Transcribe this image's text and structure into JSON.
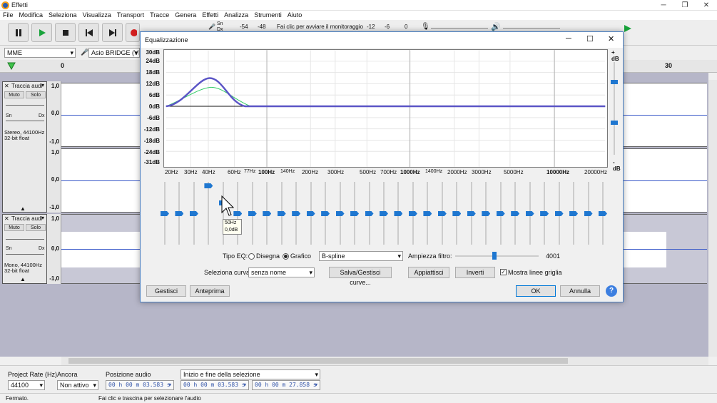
{
  "window": {
    "title": "Effetti"
  },
  "menu": [
    "File",
    "Modifica",
    "Seleziona",
    "Visualizza",
    "Transport",
    "Tracce",
    "Genera",
    "Effetti",
    "Analizza",
    "Strumenti",
    "Aiuto"
  ],
  "meter": {
    "ticks": [
      "-54",
      "-48",
      "-12",
      "-6",
      "0"
    ],
    "monitor_text": "Fai clic per avviare il monitoraggio",
    "rec_labels": [
      "Sn",
      "Dx"
    ]
  },
  "device": {
    "host": "MME",
    "input": "Asio BRIDGE (VB-Au"
  },
  "ruler": {
    "left": "0",
    "right": "30"
  },
  "tracks": [
    {
      "name": "Traccia audi",
      "mute": "Muto",
      "solo": "Solo",
      "pan_l": "Sn",
      "pan_r": "Dx",
      "info1": "Stereo, 44100Hz",
      "info2": "32-bit float",
      "scale": [
        "1,0",
        "0,0",
        "-1,0",
        "1,0",
        "0,0",
        "-1,0"
      ]
    },
    {
      "name": "Traccia audi",
      "mute": "Muto",
      "solo": "Solo",
      "pan_l": "Sn",
      "pan_r": "Dx",
      "info1": "Mono, 44100Hz",
      "info2": "32-bit float",
      "scale": [
        "1,0",
        "0,0",
        "-1,0"
      ]
    }
  ],
  "dialog": {
    "title": "Equalizzazione",
    "db_labels": [
      "30dB",
      "24dB",
      "18dB",
      "12dB",
      "6dB",
      "0dB",
      "-6dB",
      "-12dB",
      "-18dB",
      "-24dB",
      "-31dB"
    ],
    "right_top": "+ dB",
    "right_bottom": "- dB",
    "freq_labels": [
      "20Hz",
      "30Hz",
      "40Hz",
      "60Hz",
      "77Hz",
      "100Hz",
      "140Hz",
      "200Hz",
      "300Hz",
      "500Hz",
      "700Hz",
      "1000Hz",
      "1400Hz",
      "2000Hz",
      "3000Hz",
      "5000Hz",
      "10000Hz",
      "20000Hz"
    ],
    "tooltip": [
      "50Hz",
      "0,0dB"
    ],
    "tipo_eq": "Tipo EQ:",
    "disegna": "Disegna",
    "grafico": "Grafico",
    "interp": "B-spline",
    "ampiezza": "Ampiezza filtro:",
    "ampiezza_value": "4001",
    "seleziona_curva": "Seleziona curva:",
    "curva": "senza nome",
    "salva": "Salva/Gestisci curve...",
    "appiattisci": "Appiattisci",
    "inverti": "Inverti",
    "mostra": "Mostra linee griglia",
    "gestisci": "Gestisci",
    "anteprima": "Anteprima",
    "ok": "OK",
    "annulla": "Annulla",
    "help": "?"
  },
  "bottom": {
    "rate_label": "Project Rate (Hz)",
    "rate": "44100",
    "ancora_label": "Ancora",
    "ancora": "Non attivo",
    "pos_label": "Posizione audio",
    "pos": "00 h 00 m 03.583 s",
    "sel_label": "Inizio e fine della selezione",
    "sel_start": "00 h 00 m 03.583 s",
    "sel_end": "00 h 00 m 27.858 s"
  },
  "status": {
    "left": "Fermato.",
    "right": "Fai clic e trascina per selezionare l'audio"
  },
  "colors": {
    "accent": "#0078d7",
    "curve": "#5b55c6",
    "green": "#33cc66",
    "wave": "#3a59c9"
  }
}
